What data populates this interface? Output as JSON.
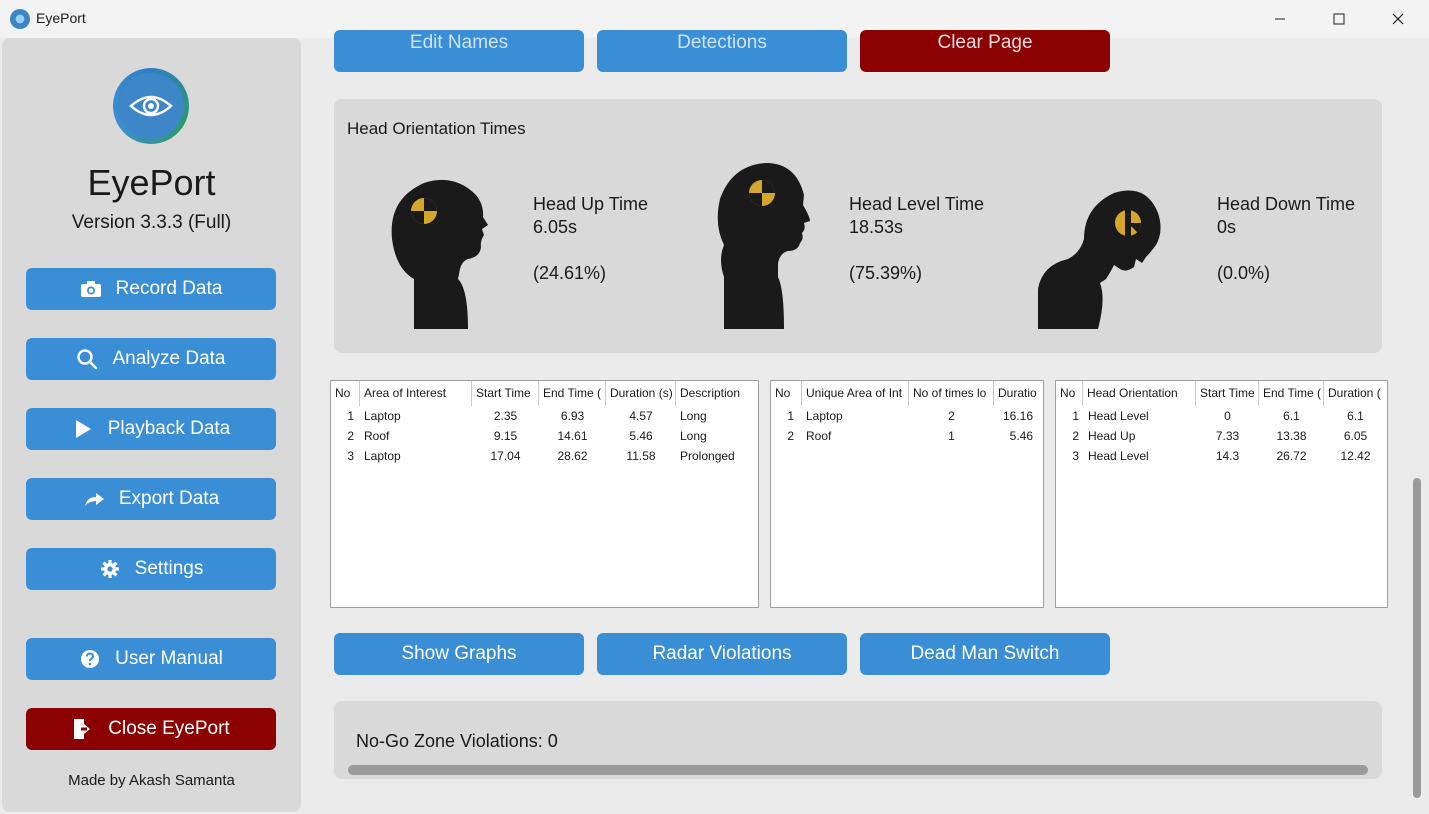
{
  "window": {
    "title": "EyePort",
    "controls": {
      "minimize": "—",
      "maximize": "☐",
      "close": "✕"
    }
  },
  "sidebar": {
    "app_name": "EyePort",
    "version": "Version 3.3.3 (Full)",
    "buttons": {
      "record": "Record Data",
      "analyze": "Analyze Data",
      "playback": "Playback Data",
      "export": "Export Data",
      "settings": "Settings",
      "manual": "User Manual",
      "close": "Close EyePort"
    },
    "made_by": "Made by Akash Samanta"
  },
  "toolbar": {
    "edit_names": "Edit Names",
    "detections": "Detections",
    "clear_page": "Clear Page"
  },
  "head_orientation": {
    "title": "Head Orientation Times",
    "up": {
      "label": "Head Up Time",
      "value": "6.05s",
      "percent": "(24.61%)"
    },
    "level": {
      "label": "Head Level Time",
      "value": "18.53s",
      "percent": "(75.39%)"
    },
    "down": {
      "label": "Head Down Time",
      "value": "0s",
      "percent": "(0.0%)"
    }
  },
  "table_aoi": {
    "headers": [
      "No",
      "Area of Interest",
      "Start Time",
      "End Time (",
      "Duration (s)",
      "Description"
    ],
    "rows": [
      [
        "1",
        "Laptop",
        "2.35",
        "6.93",
        "4.57",
        "Long"
      ],
      [
        "2",
        "Roof",
        "9.15",
        "14.61",
        "5.46",
        "Long"
      ],
      [
        "3",
        "Laptop",
        "17.04",
        "28.62",
        "11.58",
        "Prolonged"
      ]
    ]
  },
  "table_unique": {
    "headers": [
      "No",
      "Unique Area of Int",
      "No of times lo",
      "Duratio"
    ],
    "rows": [
      [
        "1",
        "Laptop",
        "2",
        "16.16"
      ],
      [
        "2",
        "Roof",
        "1",
        "5.46"
      ]
    ]
  },
  "table_head": {
    "headers": [
      "No",
      "Head Orientation",
      "Start Time",
      "End Time (",
      "Duration ("
    ],
    "rows": [
      [
        "1",
        "Head Level",
        "0",
        "6.1",
        "6.1"
      ],
      [
        "2",
        "Head Up",
        "7.33",
        "13.38",
        "6.05"
      ],
      [
        "3",
        "Head Level",
        "14.3",
        "26.72",
        "12.42"
      ]
    ]
  },
  "actions": {
    "show_graphs": "Show Graphs",
    "radar_violations": "Radar Violations",
    "dead_man_switch": "Dead Man Switch"
  },
  "nogo": {
    "text": "No-Go Zone Violations: 0"
  },
  "colors": {
    "accent": "#3a8ed6",
    "danger": "#8b0000",
    "panel": "#d9d9d9",
    "crash_marker": "#d4a72c"
  }
}
